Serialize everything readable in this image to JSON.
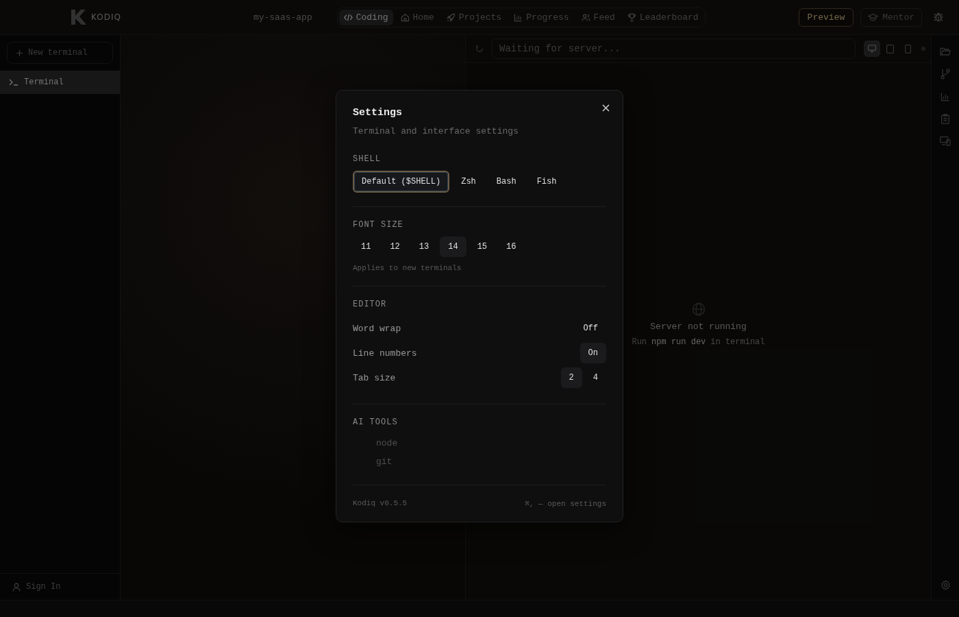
{
  "topbar": {
    "logo_text": "KODIQ",
    "project": "my-saas-app",
    "nav": [
      {
        "label": "Coding",
        "kind": "code",
        "selected": true
      },
      {
        "label": "Home",
        "kind": "home",
        "selected": false
      },
      {
        "label": "Projects",
        "kind": "projects",
        "selected": false
      },
      {
        "label": "Progress",
        "kind": "progress",
        "selected": false
      },
      {
        "label": "Feed",
        "kind": "feed",
        "selected": false
      },
      {
        "label": "Leaderboard",
        "kind": "leaderboard",
        "selected": false
      }
    ],
    "preview_button": "Preview",
    "mentor_button": "Mentor"
  },
  "sidebar": {
    "new_terminal": "New terminal",
    "terminals": [
      {
        "label": "Terminal",
        "selected": true
      }
    ],
    "sign_in": "Sign In"
  },
  "preview": {
    "url_placeholder": "Waiting for server...",
    "devices": [
      {
        "kind": "desktop",
        "selected": true
      },
      {
        "kind": "tablet",
        "selected": false
      },
      {
        "kind": "phone",
        "selected": false
      }
    ],
    "empty_title": "Server not running",
    "hint_before": "Run",
    "hint_command": "npm run dev",
    "hint_after": "in terminal"
  },
  "settings": {
    "title": "Settings",
    "subtitle": "Terminal and interface settings",
    "shell": {
      "heading": "SHELL",
      "options": [
        {
          "label": "Default ($SHELL)",
          "selected": true
        },
        {
          "label": "Zsh",
          "selected": false
        },
        {
          "label": "Bash",
          "selected": false
        },
        {
          "label": "Fish",
          "selected": false
        }
      ]
    },
    "font_size": {
      "heading": "FONT SIZE",
      "options": [
        {
          "label": "11",
          "selected": false
        },
        {
          "label": "12",
          "selected": false
        },
        {
          "label": "13",
          "selected": false
        },
        {
          "label": "14",
          "selected": true
        },
        {
          "label": "15",
          "selected": false
        },
        {
          "label": "16",
          "selected": false
        }
      ],
      "note": "Applies to new terminals"
    },
    "editor": {
      "heading": "EDITOR",
      "rows": [
        {
          "label": "Word wrap",
          "options": [
            {
              "label": "Off",
              "selected": false
            }
          ]
        },
        {
          "label": "Line numbers",
          "options": [
            {
              "label": "On",
              "selected": true
            }
          ]
        },
        {
          "label": "Tab size",
          "options": [
            {
              "label": "2",
              "selected": true
            },
            {
              "label": "4",
              "selected": false
            }
          ]
        }
      ]
    },
    "ai_tools": {
      "heading": "AI TOOLS",
      "items": [
        "node",
        "git"
      ]
    },
    "version": "Kodiq v0.5.5",
    "shortcut": "⌘, — open settings"
  }
}
